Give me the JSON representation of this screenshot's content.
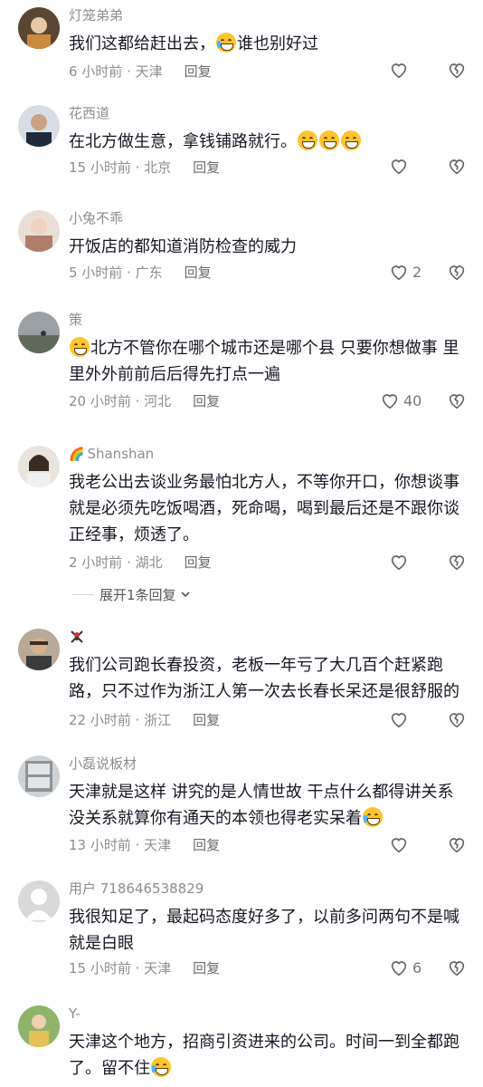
{
  "comments": [
    {
      "username": "灯笼弟弟",
      "badge": "",
      "text_parts": [
        "我们这都给赶出去，",
        "谁也别好过"
      ],
      "emoji": [
        "",
        "laugh-cry"
      ],
      "time": "6 小时前 · 天津",
      "reply": "回复",
      "likes": ""
    },
    {
      "username": "花西道",
      "badge": "",
      "text_parts": [
        "在北方做生意，拿钱铺路就行。",
        ""
      ],
      "emoji": [
        "",
        "grin-x3"
      ],
      "time": "15 小时前 · 北京",
      "reply": "回复",
      "likes": ""
    },
    {
      "username": "小兔不乖",
      "badge": "",
      "text_parts": [
        "开饭店的都知道消防检查的威力",
        ""
      ],
      "emoji": [
        "",
        ""
      ],
      "time": "5 小时前 · 广东",
      "reply": "回复",
      "likes": "2"
    },
    {
      "username": "策",
      "badge": "",
      "text_parts": [
        "",
        "北方不管你在哪个城市还是哪个县 只要你想做事 里里外外前前后后得先打点一遍"
      ],
      "emoji": [
        "grin",
        ""
      ],
      "time": "20 小时前 · 河北",
      "reply": "回复",
      "likes": "40"
    },
    {
      "username": "Shanshan",
      "badge": "🌈",
      "text_parts": [
        "我老公出去谈业务最怕北方人，不等你开口，你想谈事就是必须先吃饭喝酒，死命喝，喝到最后还是不跟你谈正经事，烦透了。",
        ""
      ],
      "emoji": [
        "",
        ""
      ],
      "time": "2 小时前 · 湖北",
      "reply": "回复",
      "likes": "",
      "expand": "展开1条回复"
    },
    {
      "username": "",
      "badge": "",
      "text_parts": [
        "我们公司跑长春投资，老板一年亏了大几百个赶紧跑路，只不过作为浙江人第一次去长春长呆还是很舒服的",
        ""
      ],
      "emoji": [
        "",
        ""
      ],
      "time": "22 小时前 · 浙江",
      "reply": "回复",
      "likes": ""
    },
    {
      "username": "小磊说板材",
      "badge": "",
      "text_parts": [
        "天津就是这样 讲究的是人情世故 干点什么都得讲关系 没关系就算你有通天的本领也得老实呆着",
        ""
      ],
      "emoji": [
        "",
        "laugh-cry"
      ],
      "time": "13 小时前 · 天津",
      "reply": "回复",
      "likes": ""
    },
    {
      "username": "用户 718646538829",
      "badge": "",
      "text_parts": [
        "我很知足了，最起码态度好多了，以前多问两句不是喊就是白眼",
        ""
      ],
      "emoji": [
        "",
        ""
      ],
      "time": "15 小时前 · 天津",
      "reply": "回复",
      "likes": "6"
    },
    {
      "username": "Y-",
      "badge": "",
      "text_parts": [
        "天津这个地方，招商引资进来的公司。时间一到全都跑了。留不住",
        ""
      ],
      "emoji": [
        "",
        "cry"
      ],
      "time": "",
      "reply": "",
      "likes": ""
    }
  ],
  "icons": {
    "like": "heart-icon",
    "dislike": "broken-heart-icon",
    "expand": "chevron-down-icon"
  },
  "colors": {
    "meta": "#8d8d8d",
    "text": "#161823",
    "avatar_default": "#d9d9d9"
  }
}
